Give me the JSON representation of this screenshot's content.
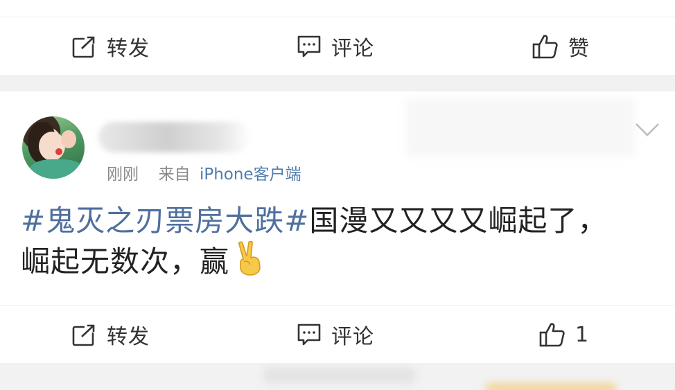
{
  "top_actions": {
    "repost_label": "转发",
    "comment_label": "评论",
    "like_label": "赞"
  },
  "post": {
    "time": "刚刚",
    "from_prefix": "来自",
    "client": "iPhone客户端",
    "hashtag": "#鬼灭之刃票房大跌#",
    "text_line1": "国漫又又又又崛起了，",
    "text_line2": "崛起无数次，赢",
    "emoji": "victory-hand-emoji"
  },
  "bottom_actions": {
    "repost_label": "转发",
    "comment_label": "评论",
    "like_count": "1"
  },
  "colors": {
    "hashtag": "#4f6f9f",
    "client_link": "#4f7cae",
    "text": "#222222",
    "divider_band": "#f1f1f1"
  }
}
